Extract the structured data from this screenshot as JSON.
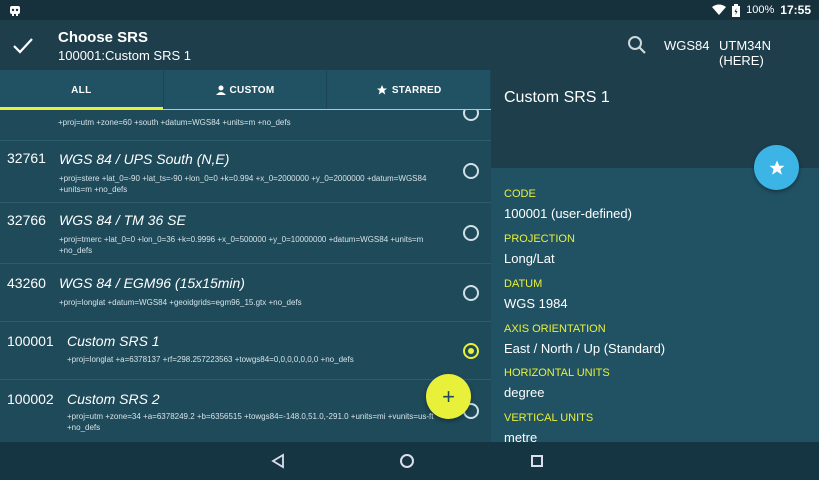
{
  "status_bar": {
    "battery": "100%",
    "time": "17:55"
  },
  "app_bar": {
    "title": "Choose SRS",
    "subtitle": "100001:Custom SRS 1",
    "action_1": "WGS84",
    "action_2": "UTM34N (HERE)"
  },
  "tabs": [
    {
      "label": "ALL",
      "icon": null
    },
    {
      "label": "CUSTOM",
      "icon": "person-icon"
    },
    {
      "label": "STARRED",
      "icon": "star-icon"
    }
  ],
  "list": {
    "rows": [
      {
        "code": "",
        "name": "",
        "def": "+proj=utm +zone=60 +south +datum=WGS84 +units=m +no_defs",
        "selected": false
      },
      {
        "code": "32761",
        "name": "WGS 84 / UPS South (N,E)",
        "def": "+proj=stere +lat_0=-90 +lat_ts=-90 +lon_0=0 +k=0.994 +x_0=2000000 +y_0=2000000 +datum=WGS84 +units=m +no_defs",
        "selected": false
      },
      {
        "code": "32766",
        "name": "WGS 84 / TM 36 SE",
        "def": "+proj=tmerc +lat_0=0 +lon_0=36 +k=0.9996 +x_0=500000 +y_0=10000000 +datum=WGS84 +units=m +no_defs",
        "selected": false
      },
      {
        "code": "43260",
        "name": "WGS 84 / EGM96 (15x15min)",
        "def": "+proj=longlat +datum=WGS84 +geoidgrids=egm96_15.gtx +no_defs",
        "selected": false
      },
      {
        "code": "100001",
        "name": "Custom SRS 1",
        "def": "+proj=longlat +a=6378137 +rf=298.257223563 +towgs84=0,0,0,0,0,0,0     +no_defs",
        "selected": true
      },
      {
        "code": "100002",
        "name": "Custom SRS 2",
        "def": "+proj=utm +zone=34  +a=6378249.2 +b=6356515 +towgs84=-148.0,51.0,-291.0  +units=mi +vunits=us-ft  +no_defs",
        "selected": false
      }
    ]
  },
  "detail": {
    "title": "Custom SRS 1",
    "fields": [
      {
        "label": "CODE",
        "value": "100001 (user-defined)"
      },
      {
        "label": "PROJECTION",
        "value": "Long/Lat"
      },
      {
        "label": "DATUM",
        "value": "WGS 1984"
      },
      {
        "label": "AXIS ORIENTATION",
        "value": "East / North / Up (Standard)"
      },
      {
        "label": "HORIZONTAL UNITS",
        "value": "degree"
      },
      {
        "label": "VERTICAL UNITS",
        "value": "metre"
      }
    ]
  },
  "colors": {
    "accent": "#e8f03a",
    "fab_star": "#3db4e6",
    "background": "#1f4a5a"
  },
  "fab_add_label": "+"
}
